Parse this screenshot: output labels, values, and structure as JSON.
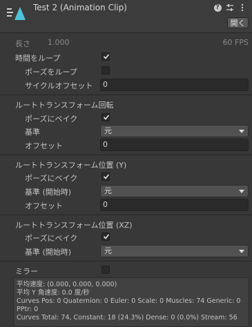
{
  "header": {
    "title": "Test 2 (Animation Clip)",
    "open_button": "開く",
    "icons": [
      "help-icon",
      "preset-icon",
      "more-icon"
    ]
  },
  "length": {
    "label": "長さ",
    "value": "1.000",
    "fps": "60 FPS"
  },
  "loop_time": {
    "label": "時間をループ",
    "checked": true,
    "loop_pose_label": "ポーズをループ",
    "loop_pose_checked": false,
    "cycle_offset_label": "サイクルオフセット",
    "cycle_offset_value": "0"
  },
  "root_rotation": {
    "section_label": "ルートトランスフォーム回転",
    "bake_label": "ポーズにベイク",
    "bake_checked": true,
    "based_on_label": "基準",
    "based_on_value": "元",
    "offset_label": "オフセット",
    "offset_value": "0"
  },
  "root_position_y": {
    "section_label": "ルートトランスフォーム位置 (Y)",
    "bake_label": "ポーズにベイク",
    "bake_checked": true,
    "based_on_label": "基準 (開始時)",
    "based_on_value": "元",
    "offset_label": "オフセット",
    "offset_value": "0"
  },
  "root_position_xz": {
    "section_label": "ルートトランスフォーム位置 (XZ)",
    "bake_label": "ポーズにベイク",
    "bake_checked": true,
    "based_on_label": "基準 (開始時)",
    "based_on_value": "元"
  },
  "mirror": {
    "label": "ミラー",
    "checked": false
  },
  "info": {
    "lines": [
      "平均速度: (0.000, 0.000, 0.000)",
      "平均 Y 角速度: 0.0 度/秒",
      "Curves Pos: 0 Quaternion: 0 Euler: 0 Scale: 0 Muscles: 74 Generic: 0",
      "PPtr: 0",
      "Curves Total: 74, Constant: 18 (24.3%) Dense: 0 (0.0%) Stream: 56"
    ]
  },
  "colors": {
    "background": "#383838",
    "header": "#3c3c3c",
    "clip_icon": "#4fc3d9"
  }
}
